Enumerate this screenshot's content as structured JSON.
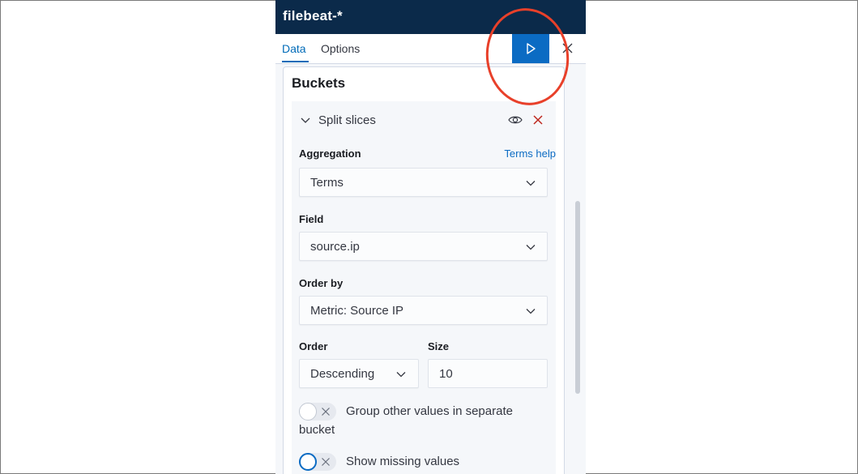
{
  "header": {
    "title": "filebeat-*"
  },
  "tabs": [
    {
      "label": "Data",
      "active": true
    },
    {
      "label": "Options",
      "active": false
    }
  ],
  "toolbar": {
    "run_icon": "play-icon",
    "close_icon": "close-icon"
  },
  "buckets": {
    "title": "Buckets",
    "aggregation": {
      "title": "Split slices",
      "aggregation_label": "Aggregation",
      "help_link": "Terms help",
      "aggregation_value": "Terms",
      "field_label": "Field",
      "field_value": "source.ip",
      "order_by_label": "Order by",
      "order_by_value": "Metric: Source IP",
      "order_label": "Order",
      "order_value": "Descending",
      "size_label": "Size",
      "size_value": "10",
      "group_other_label_line1": "Group other values in separate",
      "group_other_label_line2": "bucket",
      "group_other_on": false,
      "missing_label": "Show missing values",
      "missing_on": false
    }
  },
  "colors": {
    "header_bg": "#0b2a4a",
    "accent": "#0b6bc3",
    "remove": "#bd271e",
    "annotation": "#e8402a"
  }
}
